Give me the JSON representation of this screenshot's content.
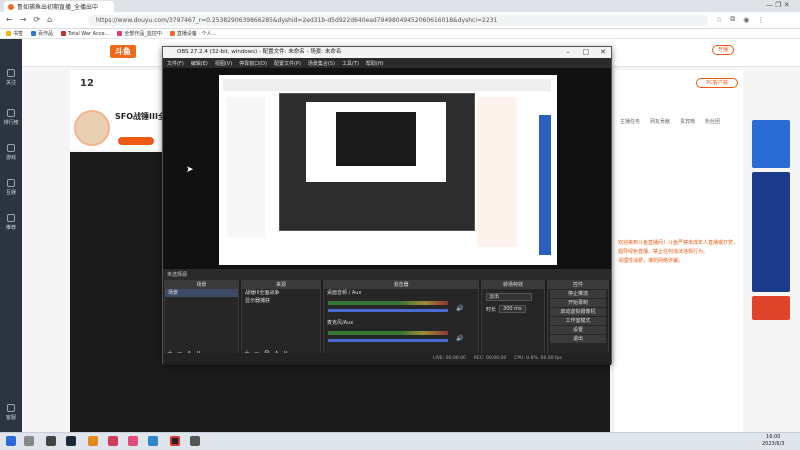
{
  "browser": {
    "tab_title": "鲁如捕鱼出初期直播_全播出中",
    "url": "https://www.douyu.com/3797467_r=0.2538290639866285&dyshid=2ed31b-d5d922d640ead79498049452060616018&dyshci=2231",
    "bookmarks": [
      "书签",
      "百作品",
      "Total War Acce...",
      "全部作品_监控中",
      "直播设备 · 个人..."
    ]
  },
  "site": {
    "logo": "斗鱼",
    "left_nav": [
      "关注",
      "排行榜",
      "游戏",
      "互娱",
      "推荐",
      "客服"
    ],
    "anchor_level": "12",
    "anchor_title": "SFO战锤III全新",
    "follow_label": "开播",
    "pc_client": "PC客户端",
    "right_tabs": [
      "主播任务",
      "网友贡献",
      "贵宾榜",
      "粉丝团"
    ],
    "right_msgs": [
      "欢迎来到斗鱼直播间！斗鱼严禁未成年人直播或打赏，",
      "倡导绿色直播，禁止任何违法违规行为。",
      "请理性消费，谨防网络诈骗。"
    ]
  },
  "obs": {
    "title": "OBS 27.2.4 (32-bit, windows) - 配置文件: 未命名 - 场景: 未命名",
    "menu": [
      "文件(F)",
      "编辑(E)",
      "视图(V)",
      "停靠窗口(D)",
      "配置文件(P)",
      "场景集合(S)",
      "工具(T)",
      "帮助(H)"
    ],
    "scene_strip": "未选择源",
    "docks": {
      "scenes_title": "场景",
      "scenes": [
        "场景"
      ],
      "sources_title": "来源",
      "sources": [
        "战锤III全面战争",
        "显示器捕获"
      ],
      "mixer_title": "混音器",
      "mixer_tracks": [
        "桌面音频 / Aux",
        "麦克风/Aux"
      ],
      "transitions_title": "转场特效",
      "transition_value": "淡出",
      "duration_label": "时长",
      "duration_value": "300 ms",
      "controls_title": "控件",
      "controls": [
        "停止推流",
        "开始录制",
        "启动虚拟摄像机",
        "工作室模式",
        "设置",
        "退出"
      ]
    },
    "status": [
      "LIVE: 00:00:00",
      "REC: 00:00:00",
      "CPU: 0.6%, 60.00 fps"
    ]
  },
  "taskbar": {
    "time": "16:00",
    "date": "2023/6/3"
  }
}
